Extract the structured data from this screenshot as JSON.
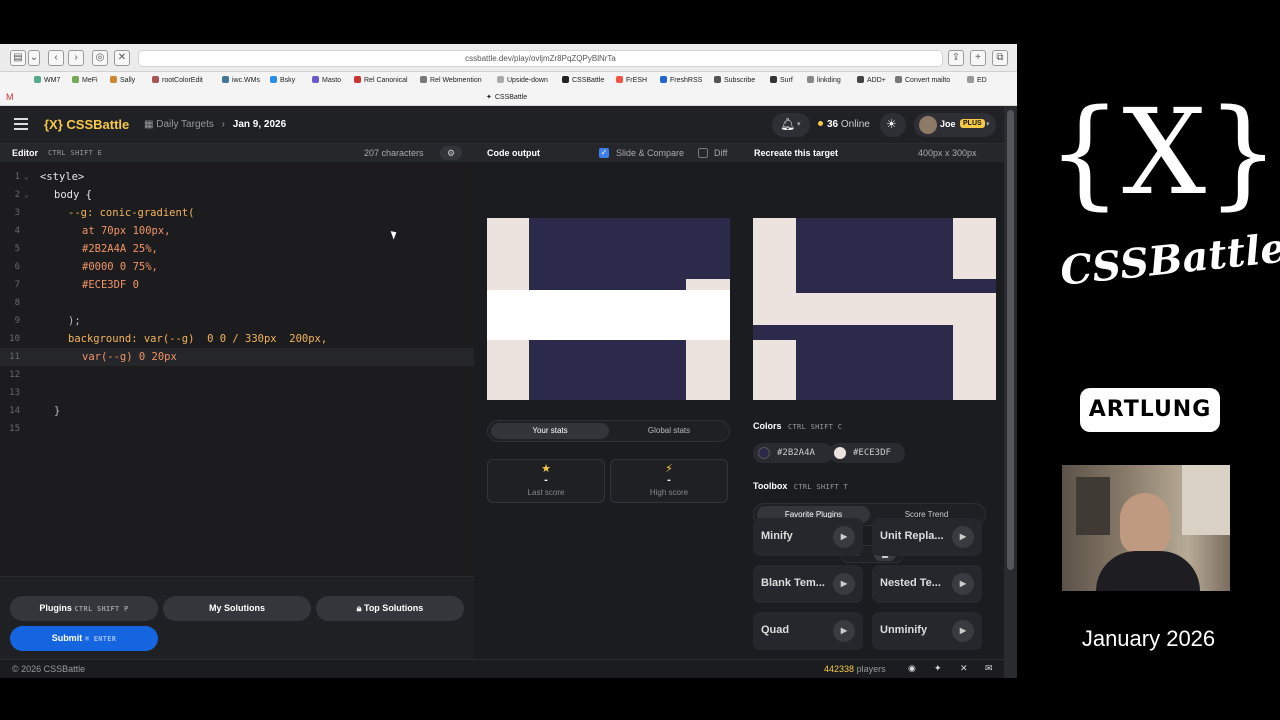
{
  "browser": {
    "url": "cssbattle.dev/play/ovljmZr8PqZQPyBlNrTa",
    "tab_title": "CSSBattle",
    "bookmarks": [
      "WM7",
      "MeFi",
      "Sally",
      "rootColorEdit",
      "iwc.WMs",
      "Bsky",
      "Masto",
      "Rel Canonical",
      "Rel Webmention",
      "Upside-down",
      "CSSBattle",
      "FrESH",
      "FreshRSS",
      "Subscribe",
      "Surf",
      "linkding",
      "ADD+",
      "Convert mailto",
      "ED"
    ]
  },
  "header": {
    "logo": "{X} CSSBattle",
    "crumb_section": "Daily Targets",
    "crumb_date": "Jan 9, 2026",
    "online_count": "36",
    "online_label": "Online",
    "user_name": "Joe",
    "user_badge": "PLUS"
  },
  "editor": {
    "label": "Editor",
    "shortcut": "CTRL SHIFT E",
    "chars": "207 characters",
    "lines": [
      {
        "n": "1",
        "text": "<style>"
      },
      {
        "n": "2",
        "text": "body {"
      },
      {
        "n": "3",
        "text": "--g: conic-gradient("
      },
      {
        "n": "4",
        "text": "at 70px 100px,"
      },
      {
        "n": "5",
        "text": "#2B2A4A 25%,"
      },
      {
        "n": "6",
        "text": "#0000 0 75%,"
      },
      {
        "n": "7",
        "text": "#ECE3DF 0"
      },
      {
        "n": "8",
        "text": ""
      },
      {
        "n": "9",
        "text": ");"
      },
      {
        "n": "10",
        "text": "background: var(--g)  0 0 / 330px  200px,"
      },
      {
        "n": "11",
        "text": "var(--g) 0 20px"
      },
      {
        "n": "12",
        "text": ""
      },
      {
        "n": "13",
        "text": ""
      },
      {
        "n": "14",
        "text": "}"
      },
      {
        "n": "15",
        "text": ""
      }
    ]
  },
  "output": {
    "label": "Code output",
    "slide_compare": "Slide & Compare",
    "diff": "Diff",
    "tab_your": "Your stats",
    "tab_global": "Global stats",
    "last_score_val": "-",
    "last_score_label": "Last score",
    "high_score_val": "-",
    "high_score_label": "High score"
  },
  "target": {
    "label": "Recreate this target",
    "size": "400px x 300px",
    "colors_label": "Colors",
    "colors_shortcut": "CTRL SHIFT C",
    "swatches": [
      {
        "hex": "#2B2A4A"
      },
      {
        "hex": "#ECE3DF"
      }
    ],
    "toolbox_label": "Toolbox",
    "toolbox_shortcut": "CTRL SHIFT T",
    "tab_fav": "Favorite Plugins",
    "tab_trend": "Score Trend",
    "plugins": [
      "Minify",
      "Unit Repla...",
      "Blank Tem...",
      "Nested Te...",
      "Quad",
      "Unminify"
    ]
  },
  "bottom": {
    "plugins_label": "Plugins",
    "plugins_shortcut": "CTRL SHIFT P",
    "my_solutions": "My Solutions",
    "top_solutions": "Top Solutions",
    "submit": "Submit",
    "submit_shortcut": "⌘ ENTER"
  },
  "footer": {
    "copyright": "© 2026 CSSBattle",
    "players_count": "442338",
    "players_label": "players"
  },
  "sidebar": {
    "brand_mark": "{X}",
    "brand_text": "CSSBattle",
    "artlung": "ARTLUNG",
    "date": "January 2026"
  },
  "colors": {
    "dark": "#2B2A4A",
    "light": "#ECE3DF",
    "accent": "#F7C948",
    "submit_blue": "#1565E0"
  }
}
